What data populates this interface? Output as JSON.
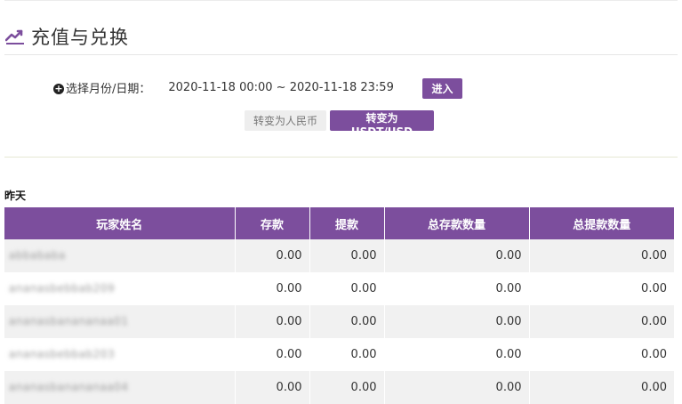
{
  "header": {
    "title": "充值与兑换",
    "icon": "trend-up-icon",
    "accent_color": "#7c4e9d"
  },
  "filter": {
    "label": "选择月份/日期：",
    "date_range": "2020-11-18 00:00 ~ 2020-11-18 23:59",
    "enter_label": "进入"
  },
  "currency": {
    "rmb_label": "转变为人民币",
    "usdt_label": "转变为USDT/USD",
    "selected": "usdt"
  },
  "section": {
    "title": "昨天"
  },
  "table": {
    "columns": [
      "玩家姓名",
      "存款",
      "提款",
      "总存款数量",
      "总提款数量"
    ],
    "rows": [
      {
        "player": "abbababa",
        "deposit": "0.00",
        "withdraw": "0.00",
        "total_deposit": "0.00",
        "total_withdraw": "0.00"
      },
      {
        "player": "ananasbebbab209",
        "deposit": "0.00",
        "withdraw": "0.00",
        "total_deposit": "0.00",
        "total_withdraw": "0.00"
      },
      {
        "player": "ananasbanananaa01",
        "deposit": "0.00",
        "withdraw": "0.00",
        "total_deposit": "0.00",
        "total_withdraw": "0.00"
      },
      {
        "player": "ananasbebbab203",
        "deposit": "0.00",
        "withdraw": "0.00",
        "total_deposit": "0.00",
        "total_withdraw": "0.00"
      },
      {
        "player": "ananasbanananaa04",
        "deposit": "0.00",
        "withdraw": "0.00",
        "total_deposit": "0.00",
        "total_withdraw": "0.00"
      }
    ]
  }
}
